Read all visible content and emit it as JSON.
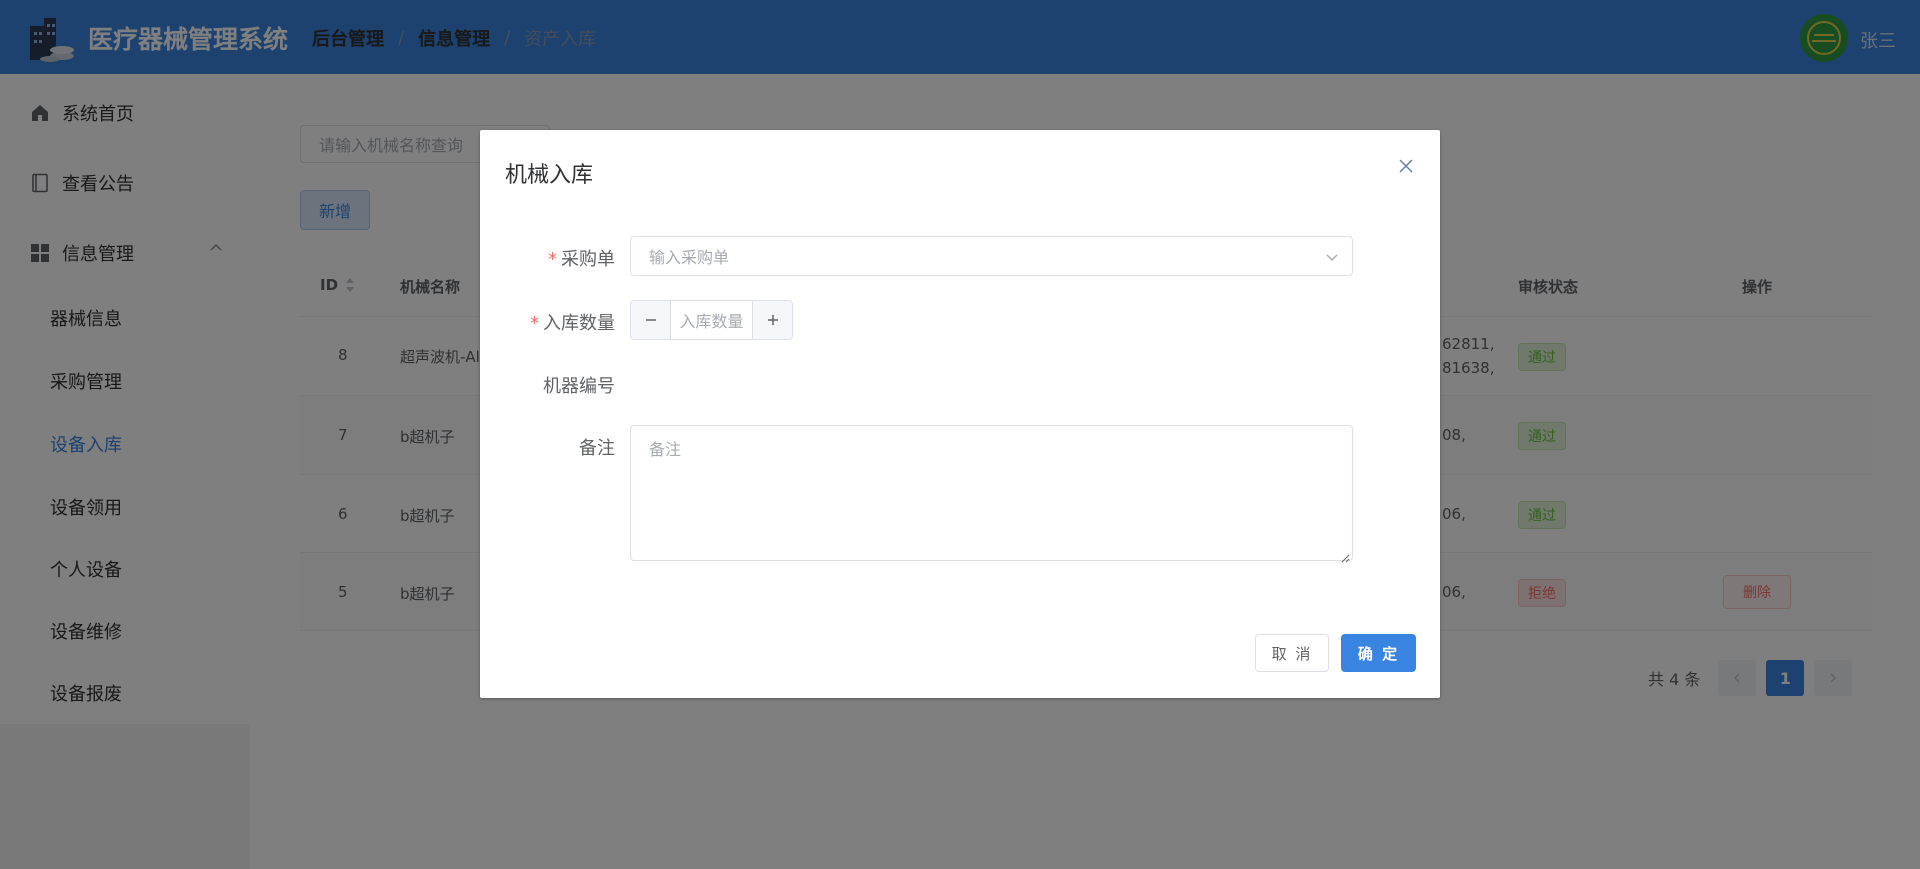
{
  "colors": {
    "primary": "#3a84e1",
    "success": "#67c23a",
    "danger": "#f56c6c",
    "required": "#f56c6c"
  },
  "header": {
    "app_title": "医疗器械管理系统",
    "breadcrumb": [
      "后台管理",
      "信息管理",
      "资产入库"
    ],
    "user_name": "张三",
    "logo_icon": "hospital-building-icon"
  },
  "sidebar": {
    "items": [
      {
        "label": "系统首页",
        "icon": "home-icon"
      },
      {
        "label": "查看公告",
        "icon": "notice-icon"
      },
      {
        "label": "信息管理",
        "icon": "grid-icon",
        "expanded": true
      }
    ],
    "sub_items": [
      "器械信息",
      "采购管理",
      "设备入库",
      "设备领用",
      "个人设备",
      "设备维修",
      "设备报废"
    ],
    "active_sub": "设备入库"
  },
  "toolbar": {
    "search_placeholder": "请输入机械名称查询",
    "add_label": "新增"
  },
  "table": {
    "headers": {
      "id": "ID",
      "name": "机械名称",
      "audit": "审核状态",
      "action": "操作"
    },
    "rows": [
      {
        "id": "8",
        "name": "超声波机-Al",
        "codes_line1": "62811,",
        "codes_line2": "81638,",
        "status": "通过",
        "action": ""
      },
      {
        "id": "7",
        "name": "b超机子",
        "codes_line1": "08,",
        "codes_line2": "",
        "status": "通过",
        "action": ""
      },
      {
        "id": "6",
        "name": "b超机子",
        "codes_line1": "06,",
        "codes_line2": "",
        "status": "通过",
        "action": ""
      },
      {
        "id": "5",
        "name": "b超机子",
        "codes_line1": "06,",
        "codes_line2": "",
        "status": "拒绝",
        "action": "删除"
      }
    ]
  },
  "pagination": {
    "total_text": "共 4 条",
    "current_page": "1",
    "prev_icon": "chevron-left-icon",
    "next_icon": "chevron-right-icon"
  },
  "dialog": {
    "title": "机械入库",
    "fields": {
      "purchase_order_label": "采购单",
      "purchase_order_placeholder": "输入采购单",
      "quantity_label": "入库数量",
      "quantity_placeholder": "入库数量",
      "machine_no_label": "机器编号",
      "remark_label": "备注",
      "remark_placeholder": "备注"
    },
    "cancel_label": "取 消",
    "confirm_label": "确 定"
  }
}
